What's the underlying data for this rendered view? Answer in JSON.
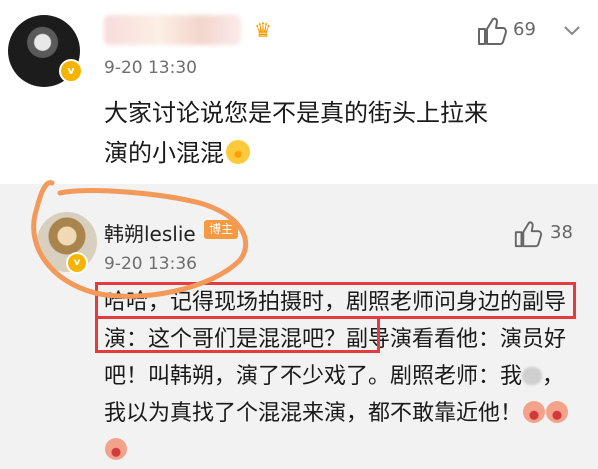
{
  "comments": [
    {
      "time": "9-20 13:30",
      "text": "大家讨论说您是不是真的街头上拉来演的小混混",
      "like_count": "69",
      "icons": {
        "avatar": "blurred-avatar",
        "verified": "verified-badge-icon",
        "crown": "crown-icon",
        "like": "thumbs-up-icon",
        "more": "chevron-down-icon"
      }
    },
    {
      "author": "韩朔leslie",
      "badge": "博主",
      "time": "9-20 13:36",
      "text_part1": "哈哈，记得现场拍摄时，剧照老师问身边的副导演：这个哥们是混混吧？副导演看看他：演员好吧！叫韩朔，演了不少戏了。剧照老师：我",
      "text_part2": "，我以为真找了个混混来演，都不敢靠近他！",
      "like_count": "38",
      "icons": {
        "avatar": "author-avatar",
        "verified": "verified-badge-icon",
        "like": "thumbs-up-icon",
        "emoji": "laughing-emoji-icon"
      }
    }
  ],
  "colors": {
    "highlight_box": "#e23c3c",
    "scribble": "#f39a5b",
    "badge": "#f69a42",
    "reply_bg": "#f2f2f2"
  }
}
